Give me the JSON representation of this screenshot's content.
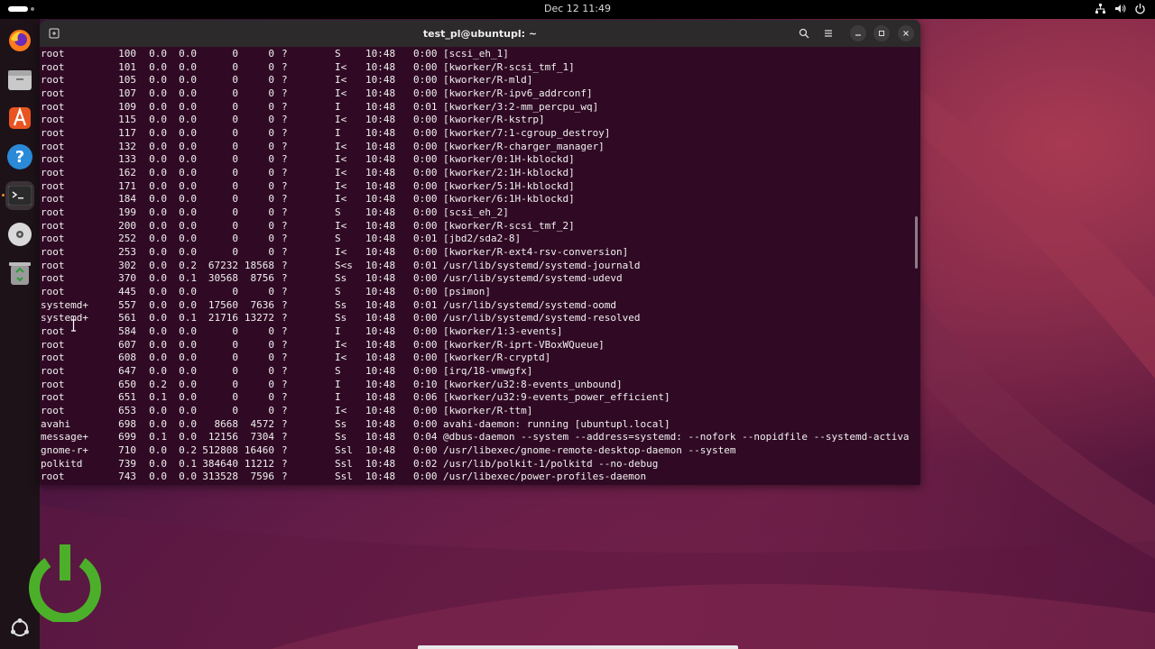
{
  "topbar": {
    "clock": "Dec 12  11:49"
  },
  "window": {
    "title": "test_pl@ubuntupl: ~"
  },
  "terminal": {
    "rows": [
      [
        "root",
        "100",
        "0.0",
        "0.0",
        "0",
        "0",
        "?",
        "S",
        "10:48",
        "0:00",
        "[scsi_eh_1]"
      ],
      [
        "root",
        "101",
        "0.0",
        "0.0",
        "0",
        "0",
        "?",
        "I<",
        "10:48",
        "0:00",
        "[kworker/R-scsi_tmf_1]"
      ],
      [
        "root",
        "105",
        "0.0",
        "0.0",
        "0",
        "0",
        "?",
        "I<",
        "10:48",
        "0:00",
        "[kworker/R-mld]"
      ],
      [
        "root",
        "107",
        "0.0",
        "0.0",
        "0",
        "0",
        "?",
        "I<",
        "10:48",
        "0:00",
        "[kworker/R-ipv6_addrconf]"
      ],
      [
        "root",
        "109",
        "0.0",
        "0.0",
        "0",
        "0",
        "?",
        "I",
        "10:48",
        "0:01",
        "[kworker/3:2-mm_percpu_wq]"
      ],
      [
        "root",
        "115",
        "0.0",
        "0.0",
        "0",
        "0",
        "?",
        "I<",
        "10:48",
        "0:00",
        "[kworker/R-kstrp]"
      ],
      [
        "root",
        "117",
        "0.0",
        "0.0",
        "0",
        "0",
        "?",
        "I",
        "10:48",
        "0:00",
        "[kworker/7:1-cgroup_destroy]"
      ],
      [
        "root",
        "132",
        "0.0",
        "0.0",
        "0",
        "0",
        "?",
        "I<",
        "10:48",
        "0:00",
        "[kworker/R-charger_manager]"
      ],
      [
        "root",
        "133",
        "0.0",
        "0.0",
        "0",
        "0",
        "?",
        "I<",
        "10:48",
        "0:00",
        "[kworker/0:1H-kblockd]"
      ],
      [
        "root",
        "162",
        "0.0",
        "0.0",
        "0",
        "0",
        "?",
        "I<",
        "10:48",
        "0:00",
        "[kworker/2:1H-kblockd]"
      ],
      [
        "root",
        "171",
        "0.0",
        "0.0",
        "0",
        "0",
        "?",
        "I<",
        "10:48",
        "0:00",
        "[kworker/5:1H-kblockd]"
      ],
      [
        "root",
        "184",
        "0.0",
        "0.0",
        "0",
        "0",
        "?",
        "I<",
        "10:48",
        "0:00",
        "[kworker/6:1H-kblockd]"
      ],
      [
        "root",
        "199",
        "0.0",
        "0.0",
        "0",
        "0",
        "?",
        "S",
        "10:48",
        "0:00",
        "[scsi_eh_2]"
      ],
      [
        "root",
        "200",
        "0.0",
        "0.0",
        "0",
        "0",
        "?",
        "I<",
        "10:48",
        "0:00",
        "[kworker/R-scsi_tmf_2]"
      ],
      [
        "root",
        "252",
        "0.0",
        "0.0",
        "0",
        "0",
        "?",
        "S",
        "10:48",
        "0:01",
        "[jbd2/sda2-8]"
      ],
      [
        "root",
        "253",
        "0.0",
        "0.0",
        "0",
        "0",
        "?",
        "I<",
        "10:48",
        "0:00",
        "[kworker/R-ext4-rsv-conversion]"
      ],
      [
        "root",
        "302",
        "0.0",
        "0.2",
        "67232",
        "18568",
        "?",
        "S<s",
        "10:48",
        "0:01",
        "/usr/lib/systemd/systemd-journald"
      ],
      [
        "root",
        "370",
        "0.0",
        "0.1",
        "30568",
        "8756",
        "?",
        "Ss",
        "10:48",
        "0:00",
        "/usr/lib/systemd/systemd-udevd"
      ],
      [
        "root",
        "445",
        "0.0",
        "0.0",
        "0",
        "0",
        "?",
        "S",
        "10:48",
        "0:00",
        "[psimon]"
      ],
      [
        "systemd+",
        "557",
        "0.0",
        "0.0",
        "17560",
        "7636",
        "?",
        "Ss",
        "10:48",
        "0:01",
        "/usr/lib/systemd/systemd-oomd"
      ],
      [
        "systemd+",
        "561",
        "0.0",
        "0.1",
        "21716",
        "13272",
        "?",
        "Ss",
        "10:48",
        "0:00",
        "/usr/lib/systemd/systemd-resolved"
      ],
      [
        "root",
        "584",
        "0.0",
        "0.0",
        "0",
        "0",
        "?",
        "I",
        "10:48",
        "0:00",
        "[kworker/1:3-events]"
      ],
      [
        "root",
        "607",
        "0.0",
        "0.0",
        "0",
        "0",
        "?",
        "I<",
        "10:48",
        "0:00",
        "[kworker/R-iprt-VBoxWQueue]"
      ],
      [
        "root",
        "608",
        "0.0",
        "0.0",
        "0",
        "0",
        "?",
        "I<",
        "10:48",
        "0:00",
        "[kworker/R-cryptd]"
      ],
      [
        "root",
        "647",
        "0.0",
        "0.0",
        "0",
        "0",
        "?",
        "S",
        "10:48",
        "0:00",
        "[irq/18-vmwgfx]"
      ],
      [
        "root",
        "650",
        "0.2",
        "0.0",
        "0",
        "0",
        "?",
        "I",
        "10:48",
        "0:10",
        "[kworker/u32:8-events_unbound]"
      ],
      [
        "root",
        "651",
        "0.1",
        "0.0",
        "0",
        "0",
        "?",
        "I",
        "10:48",
        "0:06",
        "[kworker/u32:9-events_power_efficient]"
      ],
      [
        "root",
        "653",
        "0.0",
        "0.0",
        "0",
        "0",
        "?",
        "I<",
        "10:48",
        "0:00",
        "[kworker/R-ttm]"
      ],
      [
        "avahi",
        "698",
        "0.0",
        "0.0",
        "8668",
        "4572",
        "?",
        "Ss",
        "10:48",
        "0:00",
        "avahi-daemon: running [ubuntupl.local]"
      ],
      [
        "message+",
        "699",
        "0.1",
        "0.0",
        "12156",
        "7304",
        "?",
        "Ss",
        "10:48",
        "0:04",
        "@dbus-daemon --system --address=systemd: --nofork --nopidfile --systemd-activa"
      ],
      [
        "gnome-r+",
        "710",
        "0.0",
        "0.2",
        "512808",
        "16460",
        "?",
        "Ssl",
        "10:48",
        "0:00",
        "/usr/libexec/gnome-remote-desktop-daemon --system"
      ],
      [
        "polkitd",
        "739",
        "0.0",
        "0.1",
        "384640",
        "11212",
        "?",
        "Ssl",
        "10:48",
        "0:02",
        "/usr/lib/polkit-1/polkitd --no-debug"
      ],
      [
        "root",
        "743",
        "0.0",
        "0.0",
        "313528",
        "7596",
        "?",
        "Ssl",
        "10:48",
        "0:00",
        "/usr/libexec/power-profiles-daemon"
      ]
    ]
  },
  "colors": {
    "terminal_bg": "#300a24",
    "accent": "#e95420",
    "power_logo": "#4caf2a"
  }
}
